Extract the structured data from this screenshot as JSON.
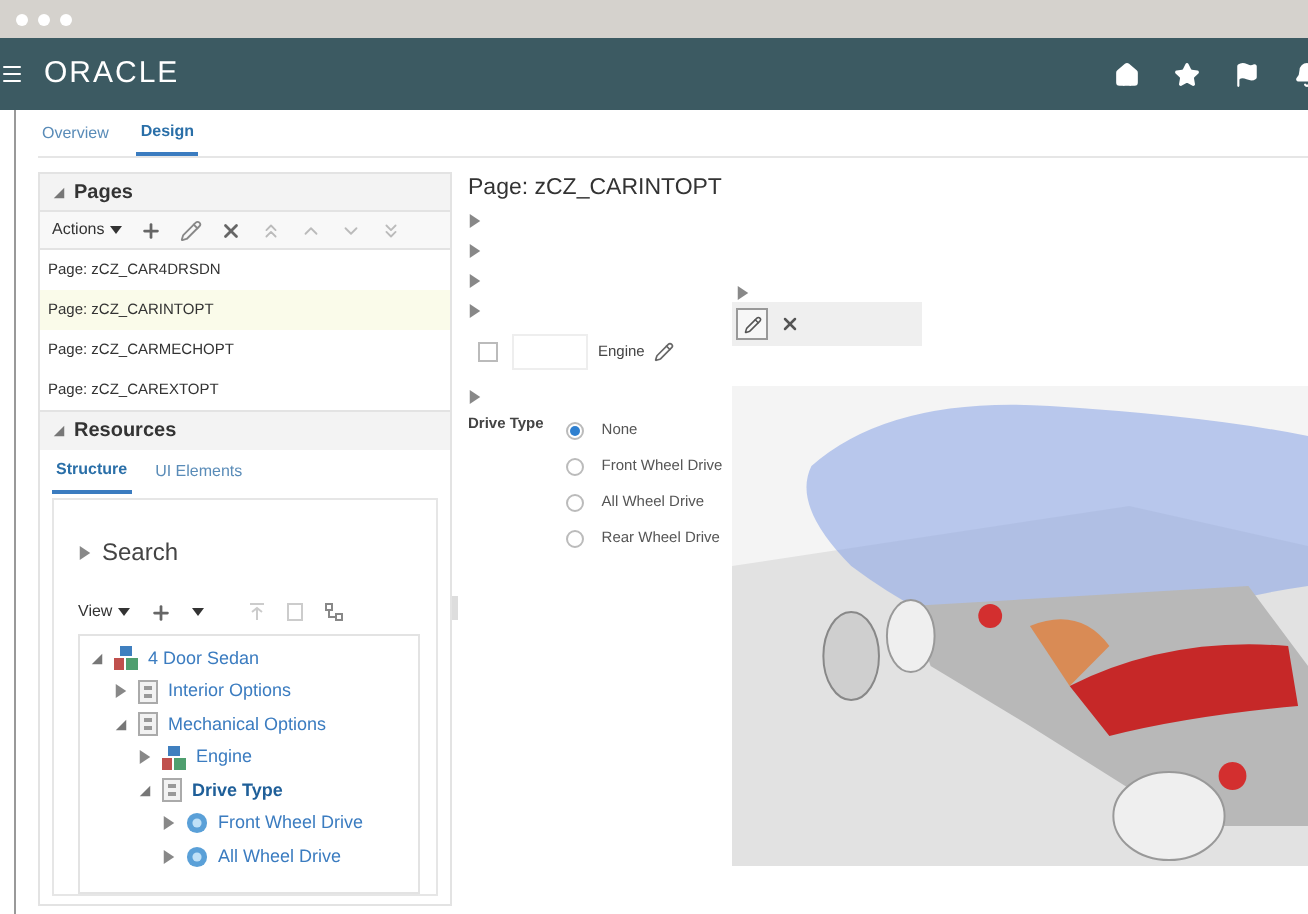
{
  "header": {
    "logo": "ORACLE"
  },
  "tabs": [
    {
      "label": "Overview",
      "selected": false
    },
    {
      "label": "Design",
      "selected": true
    }
  ],
  "pages_panel": {
    "title": "Pages",
    "actions_label": "Actions",
    "items": [
      {
        "label": "Page: zCZ_CAR4DRSDN",
        "selected": false
      },
      {
        "label": "Page: zCZ_CARINTOPT",
        "selected": true
      },
      {
        "label": "Page: zCZ_CARMECHOPT",
        "selected": false
      },
      {
        "label": "Page: zCZ_CAREXTOPT",
        "selected": false
      }
    ]
  },
  "resources_panel": {
    "title": "Resources",
    "tabs": [
      {
        "label": "Structure",
        "selected": true
      },
      {
        "label": "UI Elements",
        "selected": false
      }
    ],
    "search_label": "Search",
    "view_label": "View",
    "tree": [
      {
        "label": "4 Door Sedan",
        "kind": "model",
        "expanded": true,
        "selected": false,
        "children": [
          {
            "label": "Interior Options",
            "kind": "feature",
            "expanded": false,
            "selected": false
          },
          {
            "label": "Mechanical Options",
            "kind": "feature",
            "expanded": true,
            "selected": false,
            "children": [
              {
                "label": "Engine",
                "kind": "model",
                "expanded": false,
                "selected": false
              },
              {
                "label": "Drive Type",
                "kind": "feature",
                "expanded": true,
                "selected": true,
                "children": [
                  {
                    "label": "Front Wheel Drive",
                    "kind": "option",
                    "expanded": false,
                    "selected": false
                  },
                  {
                    "label": "All Wheel Drive",
                    "kind": "option",
                    "expanded": false,
                    "selected": false
                  }
                ]
              }
            ]
          }
        ]
      }
    ]
  },
  "designer": {
    "title": "Page: zCZ_CARINTOPT",
    "engine": {
      "label": "Engine",
      "checked": false
    },
    "drive_type": {
      "label": "Drive Type",
      "options": [
        {
          "label": "None",
          "selected": true
        },
        {
          "label": "Front Wheel Drive",
          "selected": false
        },
        {
          "label": "All Wheel Drive",
          "selected": false
        },
        {
          "label": "Rear Wheel Drive",
          "selected": false
        }
      ]
    }
  }
}
